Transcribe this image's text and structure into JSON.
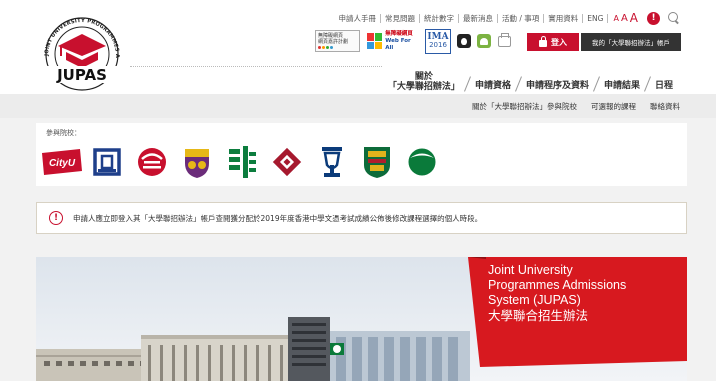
{
  "header": {
    "logo_text": "JUPAS",
    "logo_ring_text": "JOINT UNIVERSITY PROGRAMMES ADMISSIONS SYSTEM",
    "top_links": [
      "申請人手冊",
      "常見問題",
      "統計數字",
      "最新消息",
      "活動 / 事項",
      "實用資料",
      "ENG"
    ],
    "font_size_labels": [
      "A",
      "A",
      "A"
    ],
    "alert_mark": "!",
    "badges": {
      "accessible_title": "無障礙網頁",
      "accessible_sub": "網頁嘉許計劃",
      "webforall_zh": "無障礙網頁",
      "webforall_en": "Web For All",
      "ima_title": "IMA",
      "ima_year": "2016"
    },
    "login_label": "登入",
    "account_label": "我的「大學聯招辦法」帳戶",
    "main_nav": [
      {
        "line1": "關於",
        "line2": "「大學聯招辦法」"
      },
      {
        "label": "申請資格"
      },
      {
        "label": "申請程序及資料"
      },
      {
        "label": "申請結果"
      },
      {
        "label": "日程"
      }
    ]
  },
  "subnav": [
    "關於「大學聯招辦法」參與院校",
    "可選報的課程",
    "聯絡資料"
  ],
  "institutions": {
    "label": "參與院校：",
    "logos": [
      {
        "name": "cityu",
        "text": "CityU",
        "color": "#c8102e"
      },
      {
        "name": "hkbu",
        "color": "#1e3f8a"
      },
      {
        "name": "lingnan",
        "color": "#c8102e"
      },
      {
        "name": "cuhk",
        "color": "#6b2c7a"
      },
      {
        "name": "eduhk",
        "color": "#0c7d3e"
      },
      {
        "name": "polyu",
        "color": "#a6192e"
      },
      {
        "name": "hkust",
        "color": "#0b3b7a"
      },
      {
        "name": "hku",
        "color": "#0d6b3a"
      },
      {
        "name": "oupu",
        "color": "#0a7a3a"
      }
    ]
  },
  "notice": {
    "icon": "!",
    "text": "申請人應立即登入其「大學聯招辦法」帳戶查閱獲分配於2019年度香港中學文憑考試成績公佈後修改課程選擇的個人時段。"
  },
  "hero": {
    "lines": [
      "Joint University",
      "Programmes Admissions",
      "System (JUPAS)"
    ],
    "zh": "大學聯合招生辦法",
    "accent": "#d7191f"
  },
  "colors": {
    "brand_red": "#c8102e",
    "dark_button": "#333333",
    "subnav_bg": "#ececec",
    "panel_bg": "#f2f2f2"
  }
}
